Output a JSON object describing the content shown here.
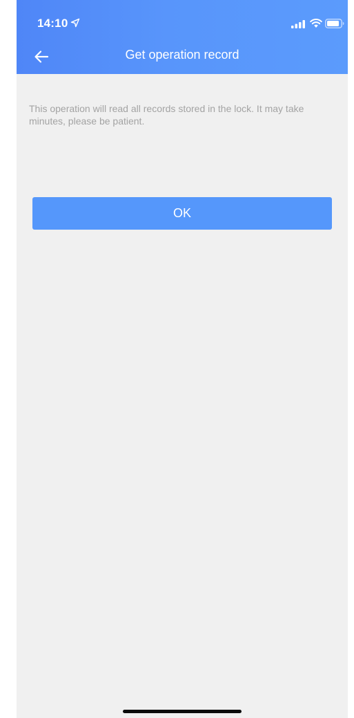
{
  "status_bar": {
    "time": "14:10",
    "icons": [
      "location-arrow-icon",
      "cellular-signal-icon",
      "wifi-icon",
      "battery-icon"
    ]
  },
  "header": {
    "title": "Get operation record",
    "back_icon": "back-arrow-icon"
  },
  "main": {
    "description": "This operation will read all records stored in the lock. It may take minutes, please be patient.",
    "ok_label": "OK"
  },
  "colors": {
    "header_start": "#4f86f7",
    "header_end": "#5b9bfc",
    "button": "#5597fb",
    "background": "#f0f0f0",
    "description_text": "#a3a3a3"
  }
}
